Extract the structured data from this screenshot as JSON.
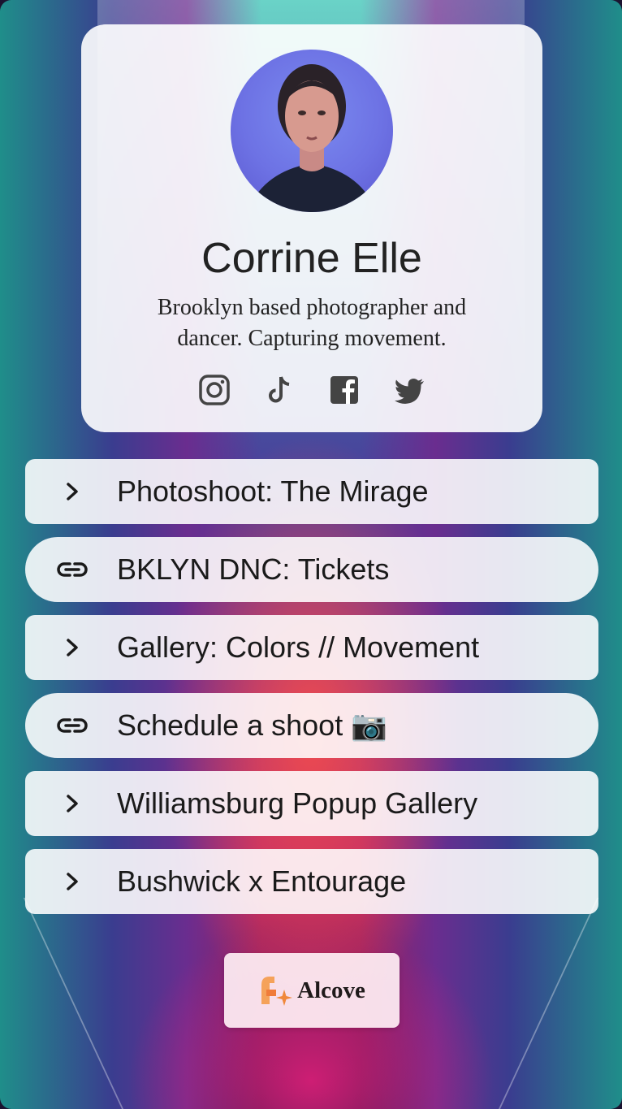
{
  "profile": {
    "name": "Corrine Elle",
    "bio": "Brooklyn based photographer and dancer. Capturing movement."
  },
  "social": [
    {
      "icon": "instagram-icon"
    },
    {
      "icon": "tiktok-icon"
    },
    {
      "icon": "facebook-icon"
    },
    {
      "icon": "twitter-icon"
    }
  ],
  "links": [
    {
      "label": "Photoshoot: The Mirage",
      "icon": "chevron-right-icon"
    },
    {
      "label": "BKLYN DNC: Tickets",
      "icon": "link-icon"
    },
    {
      "label": "Gallery: Colors // Movement",
      "icon": "chevron-right-icon"
    },
    {
      "label": "Schedule a shoot 📷",
      "icon": "link-icon"
    },
    {
      "label": "Williamsburg Popup Gallery",
      "icon": "chevron-right-icon"
    },
    {
      "label": "Bushwick x Entourage",
      "icon": "chevron-right-icon"
    }
  ],
  "brand": {
    "name": "Alcove"
  },
  "colors": {
    "text": "#1a1a1a",
    "brand_accent": "#f0883a"
  }
}
